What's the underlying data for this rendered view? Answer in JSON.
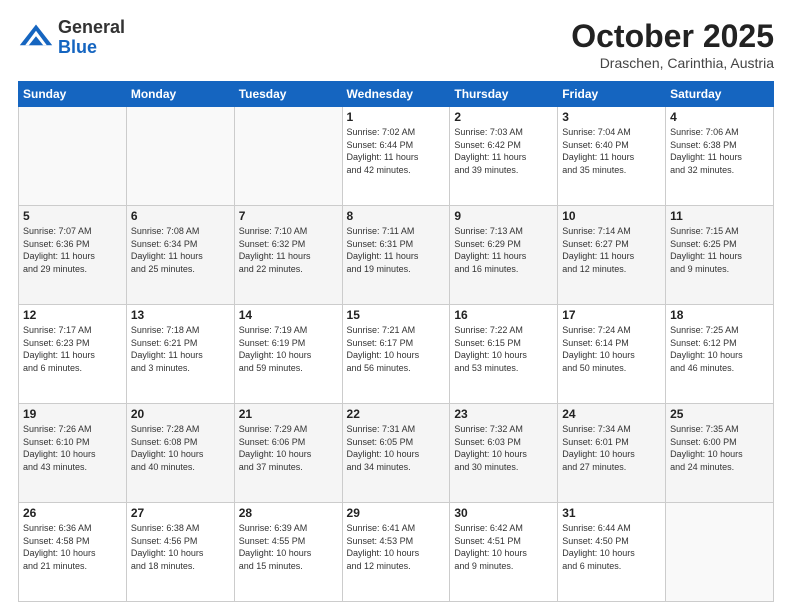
{
  "header": {
    "logo_general": "General",
    "logo_blue": "Blue",
    "month_title": "October 2025",
    "location": "Draschen, Carinthia, Austria"
  },
  "calendar": {
    "days_of_week": [
      "Sunday",
      "Monday",
      "Tuesday",
      "Wednesday",
      "Thursday",
      "Friday",
      "Saturday"
    ],
    "weeks": [
      [
        {
          "day": "",
          "info": ""
        },
        {
          "day": "",
          "info": ""
        },
        {
          "day": "",
          "info": ""
        },
        {
          "day": "1",
          "info": "Sunrise: 7:02 AM\nSunset: 6:44 PM\nDaylight: 11 hours\nand 42 minutes."
        },
        {
          "day": "2",
          "info": "Sunrise: 7:03 AM\nSunset: 6:42 PM\nDaylight: 11 hours\nand 39 minutes."
        },
        {
          "day": "3",
          "info": "Sunrise: 7:04 AM\nSunset: 6:40 PM\nDaylight: 11 hours\nand 35 minutes."
        },
        {
          "day": "4",
          "info": "Sunrise: 7:06 AM\nSunset: 6:38 PM\nDaylight: 11 hours\nand 32 minutes."
        }
      ],
      [
        {
          "day": "5",
          "info": "Sunrise: 7:07 AM\nSunset: 6:36 PM\nDaylight: 11 hours\nand 29 minutes."
        },
        {
          "day": "6",
          "info": "Sunrise: 7:08 AM\nSunset: 6:34 PM\nDaylight: 11 hours\nand 25 minutes."
        },
        {
          "day": "7",
          "info": "Sunrise: 7:10 AM\nSunset: 6:32 PM\nDaylight: 11 hours\nand 22 minutes."
        },
        {
          "day": "8",
          "info": "Sunrise: 7:11 AM\nSunset: 6:31 PM\nDaylight: 11 hours\nand 19 minutes."
        },
        {
          "day": "9",
          "info": "Sunrise: 7:13 AM\nSunset: 6:29 PM\nDaylight: 11 hours\nand 16 minutes."
        },
        {
          "day": "10",
          "info": "Sunrise: 7:14 AM\nSunset: 6:27 PM\nDaylight: 11 hours\nand 12 minutes."
        },
        {
          "day": "11",
          "info": "Sunrise: 7:15 AM\nSunset: 6:25 PM\nDaylight: 11 hours\nand 9 minutes."
        }
      ],
      [
        {
          "day": "12",
          "info": "Sunrise: 7:17 AM\nSunset: 6:23 PM\nDaylight: 11 hours\nand 6 minutes."
        },
        {
          "day": "13",
          "info": "Sunrise: 7:18 AM\nSunset: 6:21 PM\nDaylight: 11 hours\nand 3 minutes."
        },
        {
          "day": "14",
          "info": "Sunrise: 7:19 AM\nSunset: 6:19 PM\nDaylight: 10 hours\nand 59 minutes."
        },
        {
          "day": "15",
          "info": "Sunrise: 7:21 AM\nSunset: 6:17 PM\nDaylight: 10 hours\nand 56 minutes."
        },
        {
          "day": "16",
          "info": "Sunrise: 7:22 AM\nSunset: 6:15 PM\nDaylight: 10 hours\nand 53 minutes."
        },
        {
          "day": "17",
          "info": "Sunrise: 7:24 AM\nSunset: 6:14 PM\nDaylight: 10 hours\nand 50 minutes."
        },
        {
          "day": "18",
          "info": "Sunrise: 7:25 AM\nSunset: 6:12 PM\nDaylight: 10 hours\nand 46 minutes."
        }
      ],
      [
        {
          "day": "19",
          "info": "Sunrise: 7:26 AM\nSunset: 6:10 PM\nDaylight: 10 hours\nand 43 minutes."
        },
        {
          "day": "20",
          "info": "Sunrise: 7:28 AM\nSunset: 6:08 PM\nDaylight: 10 hours\nand 40 minutes."
        },
        {
          "day": "21",
          "info": "Sunrise: 7:29 AM\nSunset: 6:06 PM\nDaylight: 10 hours\nand 37 minutes."
        },
        {
          "day": "22",
          "info": "Sunrise: 7:31 AM\nSunset: 6:05 PM\nDaylight: 10 hours\nand 34 minutes."
        },
        {
          "day": "23",
          "info": "Sunrise: 7:32 AM\nSunset: 6:03 PM\nDaylight: 10 hours\nand 30 minutes."
        },
        {
          "day": "24",
          "info": "Sunrise: 7:34 AM\nSunset: 6:01 PM\nDaylight: 10 hours\nand 27 minutes."
        },
        {
          "day": "25",
          "info": "Sunrise: 7:35 AM\nSunset: 6:00 PM\nDaylight: 10 hours\nand 24 minutes."
        }
      ],
      [
        {
          "day": "26",
          "info": "Sunrise: 6:36 AM\nSunset: 4:58 PM\nDaylight: 10 hours\nand 21 minutes."
        },
        {
          "day": "27",
          "info": "Sunrise: 6:38 AM\nSunset: 4:56 PM\nDaylight: 10 hours\nand 18 minutes."
        },
        {
          "day": "28",
          "info": "Sunrise: 6:39 AM\nSunset: 4:55 PM\nDaylight: 10 hours\nand 15 minutes."
        },
        {
          "day": "29",
          "info": "Sunrise: 6:41 AM\nSunset: 4:53 PM\nDaylight: 10 hours\nand 12 minutes."
        },
        {
          "day": "30",
          "info": "Sunrise: 6:42 AM\nSunset: 4:51 PM\nDaylight: 10 hours\nand 9 minutes."
        },
        {
          "day": "31",
          "info": "Sunrise: 6:44 AM\nSunset: 4:50 PM\nDaylight: 10 hours\nand 6 minutes."
        },
        {
          "day": "",
          "info": ""
        }
      ]
    ]
  }
}
